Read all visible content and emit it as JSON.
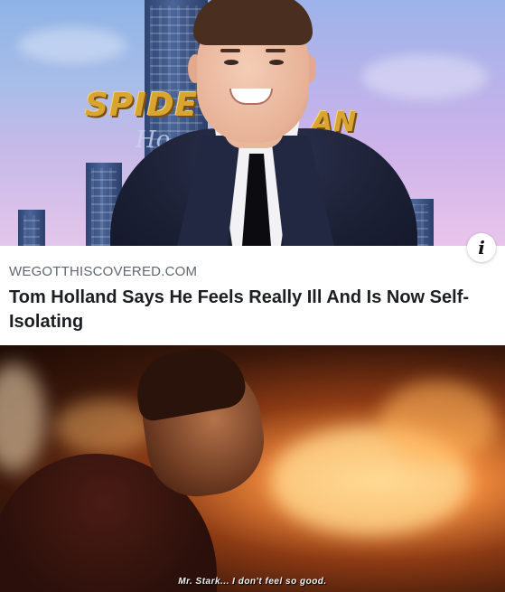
{
  "top_photo": {
    "backdrop_logo": "SPIDE",
    "backdrop_logo_end": "AN",
    "backdrop_sub": "Ho"
  },
  "article": {
    "source": "WEGOTTHISCOVERED.COM",
    "headline": "Tom Holland Says He Feels Really Ill And Is Now Self-Isolating",
    "info_icon": "i"
  },
  "movie_still": {
    "subtitle": "Mr. Stark... I don't feel so good."
  },
  "colors": {
    "headline_text": "#1c1e21",
    "source_text": "#606770",
    "logo_gold": "#d8a531"
  }
}
